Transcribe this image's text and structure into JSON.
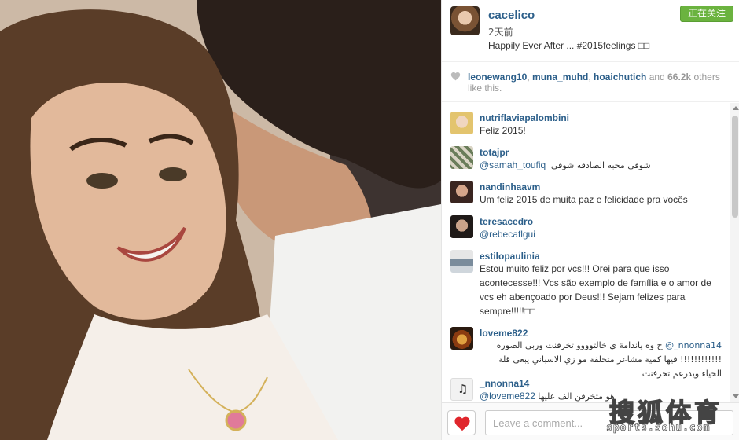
{
  "post": {
    "username": "cacelico",
    "time": "2天前",
    "caption": "Happily Ever After ... #2015feelings □□",
    "follow_label": "正在关注"
  },
  "likes": {
    "users": [
      "leonewang10",
      "muna_muhd",
      "hoaichutich"
    ],
    "and_text": "and",
    "count": "66.2k",
    "tail": "others like this."
  },
  "comments": [
    {
      "user": "nutriflaviapalombini",
      "text": "Feliz 2015!"
    },
    {
      "user": "totajpr",
      "mention": "@samah_toufiq",
      "text": "شوفي محبه الصادقه شوفي"
    },
    {
      "user": "nandinhaavm",
      "text": "Um feliz 2015 de muita paz e felicidade pra vocês"
    },
    {
      "user": "teresacedro",
      "mention": "@rebecaflgui",
      "text": ""
    },
    {
      "user": "estilopaulinia",
      "text": "Estou muito feliz por vcs!!! Orei para que isso acontecesse!!! Vcs são exemplo de família e o amor de vcs eh abençoado por Deus!!! Sejam felizes para sempre!!!!!□□"
    },
    {
      "user": "loveme822",
      "mention": "@_nnonna14",
      "text": "ح وه ياندامة ي خالتوووو تخرفنت وربي الصوره !!!!!!!!!!!! فيها كمية مشاعر متخلفة مو زي الاسباني يبغى قلة الحياء ويدرعم تخرفنت"
    },
    {
      "user": "_nnonna14",
      "mention": "@loveme822",
      "text": "هو متخرفن الف عليها"
    }
  ],
  "footer": {
    "comment_placeholder": "Leave a comment..."
  },
  "watermark": {
    "brand": "搜狐体育",
    "url": "sports.sohu.com"
  },
  "colors": {
    "link": "#2c5f8a",
    "follow_button": "#6bb33f",
    "like_heart": "#e0262c"
  }
}
